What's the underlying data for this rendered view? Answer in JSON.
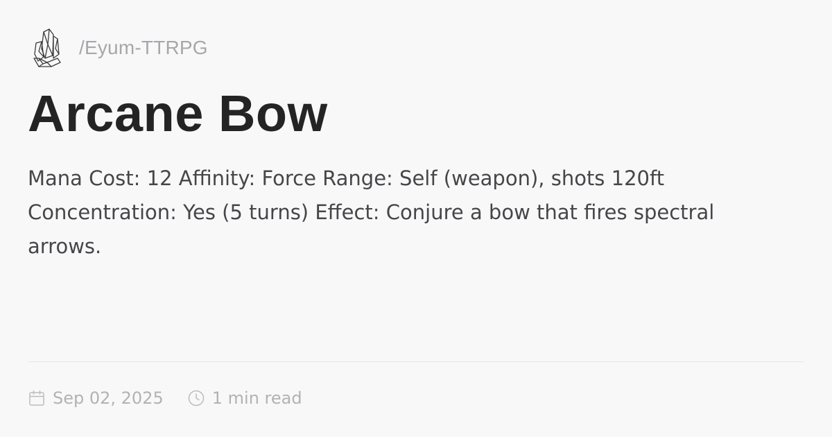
{
  "site": {
    "logo_icon": "crystal-cluster-icon",
    "path": "/Eyum-TTRPG"
  },
  "post": {
    "title": "Arcane Bow",
    "description": "Mana Cost: 12 Affinity: Force Range: Self (weapon), shots 120ft Concentration: Yes (5 turns) Effect: Conjure a bow that fires spectral arrows.",
    "date": "Sep 02, 2025",
    "read_time": "1 min read"
  },
  "icons": {
    "date": "calendar-icon",
    "read_time": "clock-icon"
  },
  "colors": {
    "background": "#f9f8f9",
    "title": "#242424",
    "body_text": "#464548",
    "muted_text": "#a8a6a9",
    "divider": "#e6e4e7"
  }
}
